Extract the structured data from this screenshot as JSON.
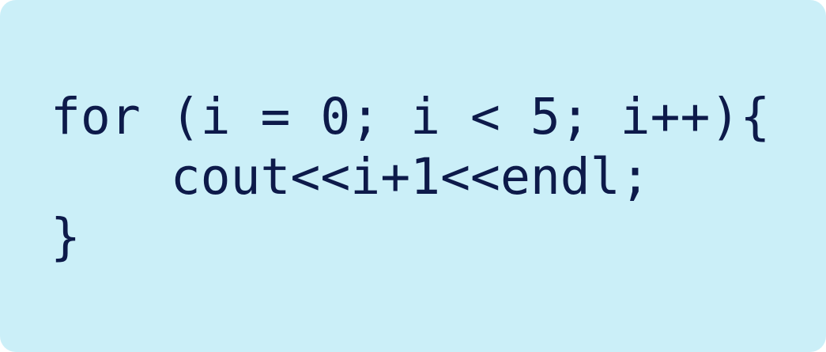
{
  "code": {
    "lines": [
      "for (i = 0; i < 5; i++){",
      "    cout<<i+1<<endl;",
      "}"
    ]
  },
  "colors": {
    "background": "#cbeff8",
    "text": "#0d1a4a"
  }
}
